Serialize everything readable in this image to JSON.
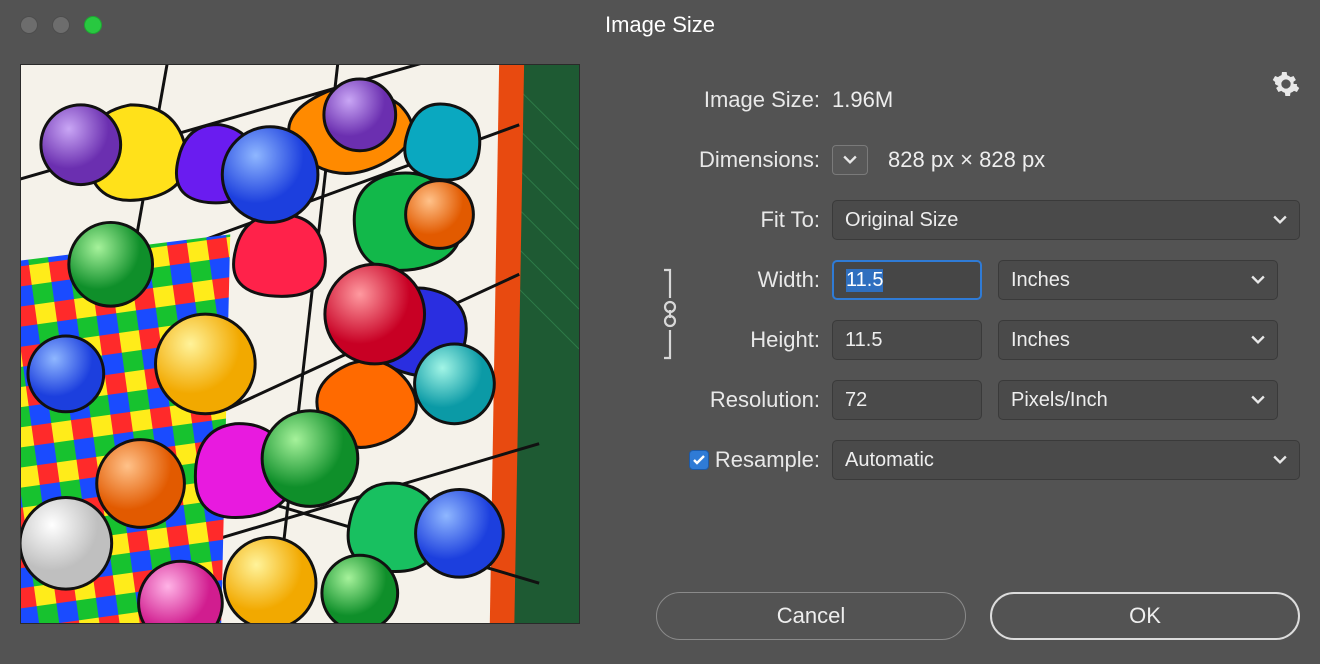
{
  "window": {
    "title": "Image Size"
  },
  "panel": {
    "imageSizeLabel": "Image Size:",
    "imageSizeValue": "1.96M",
    "dimensionsLabel": "Dimensions:",
    "dimensionsValue": "828 px  ×  828 px",
    "fitToLabel": "Fit To:",
    "fitToValue": "Original Size",
    "widthLabel": "Width:",
    "widthValue": "11.5",
    "widthUnits": "Inches",
    "heightLabel": "Height:",
    "heightValue": "11.5",
    "heightUnits": "Inches",
    "resolutionLabel": "Resolution:",
    "resolutionValue": "72",
    "resolutionUnits": "Pixels/Inch",
    "resampleLabel": "Resample:",
    "resampleChecked": true,
    "resampleValue": "Automatic"
  },
  "buttons": {
    "cancel": "Cancel",
    "ok": "OK"
  }
}
